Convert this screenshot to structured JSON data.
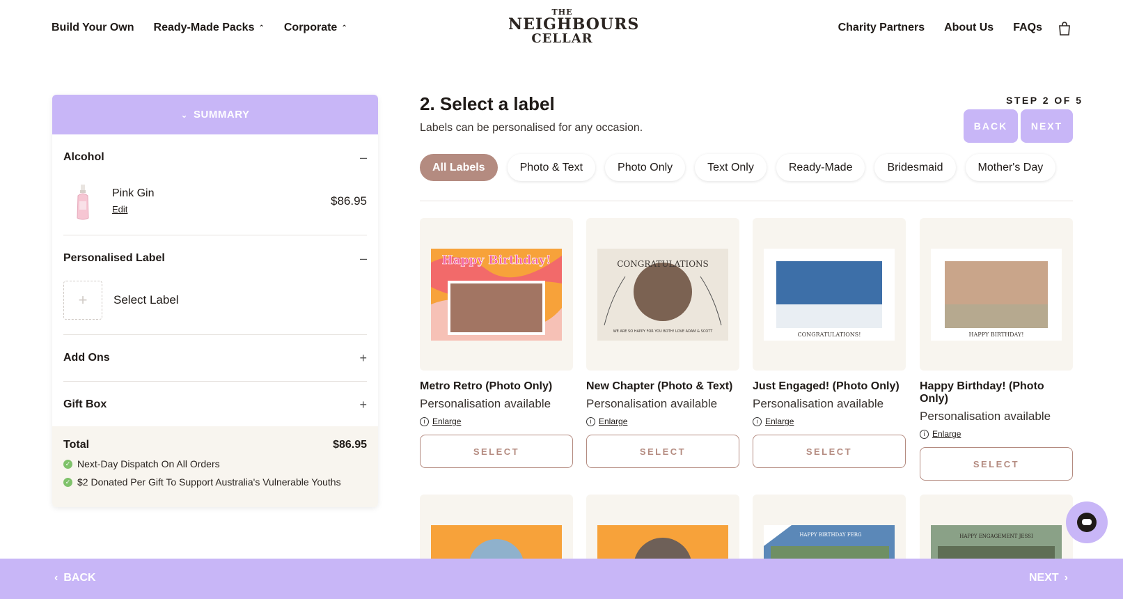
{
  "nav": {
    "left": [
      {
        "label": "Build Your Own"
      },
      {
        "label": "Ready-Made Packs"
      },
      {
        "label": "Corporate"
      }
    ],
    "right": [
      {
        "label": "Charity Partners"
      },
      {
        "label": "About Us"
      },
      {
        "label": "FAQs"
      }
    ]
  },
  "logo": {
    "the": "THE",
    "line1": "NEIGHBOURS",
    "line2": "CELLAR"
  },
  "summary": {
    "header": "SUMMARY",
    "alcohol": {
      "title": "Alcohol",
      "item_name": "Pink Gin",
      "edit": "Edit",
      "price": "$86.95"
    },
    "label": {
      "title": "Personalised Label",
      "placeholder": "Select Label"
    },
    "addons": {
      "title": "Add Ons"
    },
    "giftbox": {
      "title": "Gift Box"
    },
    "total": {
      "label": "Total",
      "value": "$86.95"
    },
    "perks": [
      "Next-Day Dispatch On All Orders",
      "$2 Donated Per Gift To Support Australia's Vulnerable Youths"
    ]
  },
  "main": {
    "title": "2. Select a label",
    "subtitle": "Labels can be personalised for any occasion.",
    "step": "STEP 2 OF 5",
    "back": "BACK",
    "next": "NEXT"
  },
  "filters": [
    "All Labels",
    "Photo & Text",
    "Photo Only",
    "Text Only",
    "Ready-Made",
    "Bridesmaid",
    "Mother's Day"
  ],
  "cards": [
    {
      "name": "Metro Retro (Photo Only)",
      "sub": "Personalisation available",
      "enlarge": "Enlarge",
      "select": "SELECT",
      "art_text": "Happy Birthday!"
    },
    {
      "name": "New Chapter (Photo & Text)",
      "sub": "Personalisation available",
      "enlarge": "Enlarge",
      "select": "SELECT",
      "art_text": "CONGRATULATIONS",
      "art_small": "WE ARE SO HAPPY FOR YOU BOTH! LOVE ADAM & SCOTT"
    },
    {
      "name": "Just Engaged! (Photo Only)",
      "sub": "Personalisation available",
      "enlarge": "Enlarge",
      "select": "SELECT",
      "art_text": "CONGRATULATIONS!"
    },
    {
      "name": "Happy Birthday! (Photo Only)",
      "sub": "Personalisation available",
      "enlarge": "Enlarge",
      "select": "SELECT",
      "art_text": "HAPPY BIRTHDAY!"
    }
  ],
  "row2": [
    {
      "art_text": ""
    },
    {
      "art_text": ""
    },
    {
      "art_text": "HAPPY BIRTHDAY FERG"
    },
    {
      "art_text": "HAPPY ENGAGEMENT JESSI"
    }
  ],
  "bottom": {
    "back": "BACK",
    "next": "NEXT"
  },
  "colors": {
    "accent": "#c8b6f7",
    "brand": "#b48b80",
    "cream": "#f8f5ef"
  }
}
